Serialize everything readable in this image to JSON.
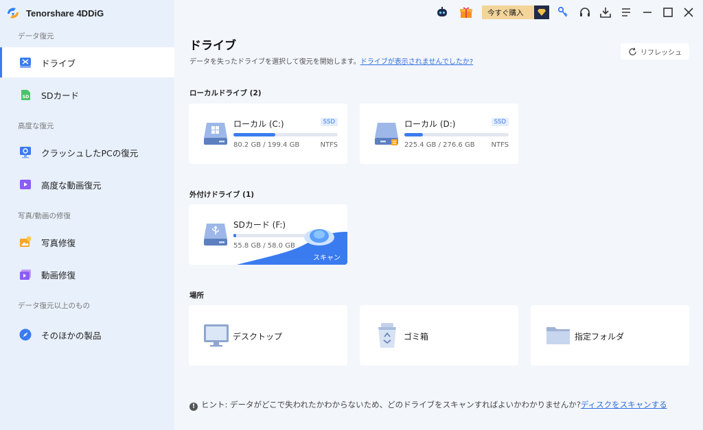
{
  "app": {
    "title": "Tenorshare 4DDiG"
  },
  "titlebar": {
    "buy_label": "今すぐ購入",
    "icons": [
      "robot-icon",
      "gift-icon",
      "key-icon",
      "headset-icon",
      "download-icon",
      "menu-icon",
      "minimize-icon",
      "maximize-icon",
      "close-icon"
    ]
  },
  "sidebar": {
    "sections": [
      {
        "label": "データ復元"
      },
      {
        "label": "高度な復元"
      },
      {
        "label": "写真/動画の修復"
      },
      {
        "label": "データ復元以上のもの"
      }
    ],
    "items": [
      {
        "label": "ドライブ",
        "icon": "drive-tool-icon",
        "active": true
      },
      {
        "label": "SDカード",
        "icon": "sd-card-icon"
      },
      {
        "label": "クラッシュしたPCの復元",
        "icon": "crashed-pc-icon"
      },
      {
        "label": "高度な動画復元",
        "icon": "video-recovery-icon"
      },
      {
        "label": "写真修復",
        "icon": "photo-repair-icon"
      },
      {
        "label": "動画修復",
        "icon": "video-repair-icon"
      },
      {
        "label": "そのほかの製品",
        "icon": "compass-icon"
      }
    ]
  },
  "main": {
    "title": "ドライブ",
    "subtitle": "データを失ったドライブを選択して復元を開始します。",
    "subtitle_link": "ドライブが表示されませんでしたか?",
    "refresh_label": "リフレッシュ",
    "local_label": "ローカルドライブ (2)",
    "local_drives": [
      {
        "name": "ローカル (C:)",
        "badge": "SSD",
        "size": "80.2 GB / 199.4 GB",
        "fs": "NTFS",
        "used": 0.4
      },
      {
        "name": "ローカル (D:)",
        "badge": "SSD",
        "size": "225.4 GB / 276.6 GB",
        "fs": "NTFS",
        "used": 0.18
      }
    ],
    "external_label": "外付けドライブ (1)",
    "external_drives": [
      {
        "name": "SDカード (F:)",
        "size": "55.8 GB / 58.0 GB",
        "used": 0.03,
        "scan_label": "スキャン"
      }
    ],
    "locations_label": "場所",
    "locations": [
      {
        "label": "デスクトップ",
        "icon": "desktop-icon"
      },
      {
        "label": "ゴミ箱",
        "icon": "recycle-bin-icon"
      },
      {
        "label": "指定フォルダ",
        "icon": "folder-icon"
      }
    ],
    "hint_prefix": "ヒント:",
    "hint_text": "データがどこで失われたかわからないため、どのドライブをスキャンすればよいかわかりませんか?",
    "hint_link": "ディスクをスキャンする"
  }
}
